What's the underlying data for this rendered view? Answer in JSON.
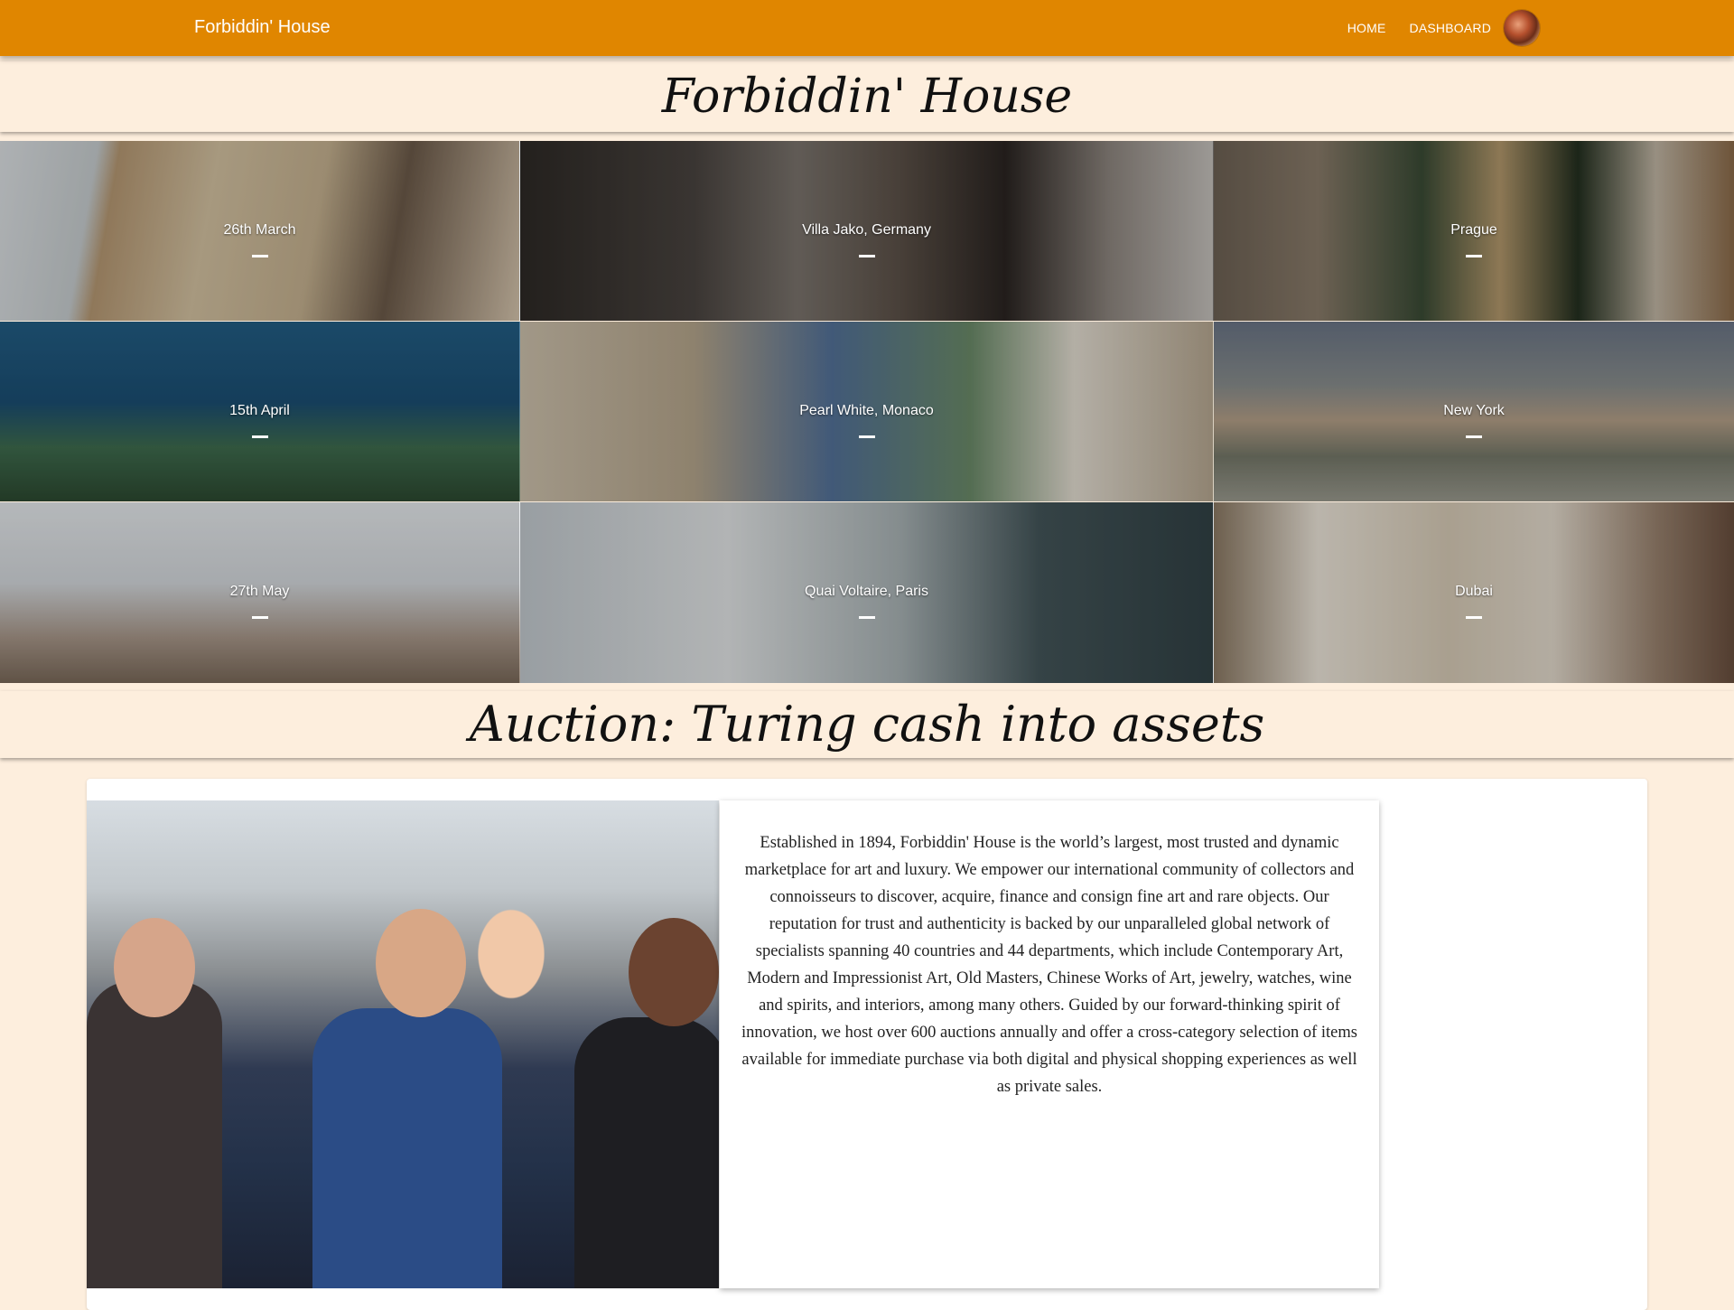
{
  "navbar": {
    "brand": "Forbiddin' House",
    "links": [
      "HOME",
      "DASHBOARD"
    ]
  },
  "hero_title": "Forbiddin' House",
  "gallery": [
    {
      "label": "26th March"
    },
    {
      "label": "Villa Jako, Germany"
    },
    {
      "label": "Prague"
    },
    {
      "label": "15th April"
    },
    {
      "label": "Pearl White, Monaco"
    },
    {
      "label": "New York"
    },
    {
      "label": "27th May"
    },
    {
      "label": "Quai Voltaire, Paris"
    },
    {
      "label": "Dubai"
    }
  ],
  "section_title": "Auction: Turing cash into assets",
  "about": {
    "text": "Established in 1894, Forbiddin' House is the world’s largest, most trusted and dynamic marketplace for art and luxury. We empower our international community of collectors and connoisseurs to discover, acquire, finance and consign fine art and rare objects. Our reputation for trust and authenticity is backed by our unparalleled global network of specialists spanning 40 countries and 44 departments, which include Contemporary Art, Modern and Impressionist Art, Old Masters, Chinese Works of Art, jewelry, watches, wine and spirits, and interiors, among many others. Guided by our forward-thinking spirit of innovation, we host over 600 auctions annually and offer a cross-category selection of items available for immediate purchase via both digital and physical shopping experiences as well as private sales."
  },
  "colors": {
    "navbar": "#e08600",
    "page_background": "#fdeedd"
  }
}
